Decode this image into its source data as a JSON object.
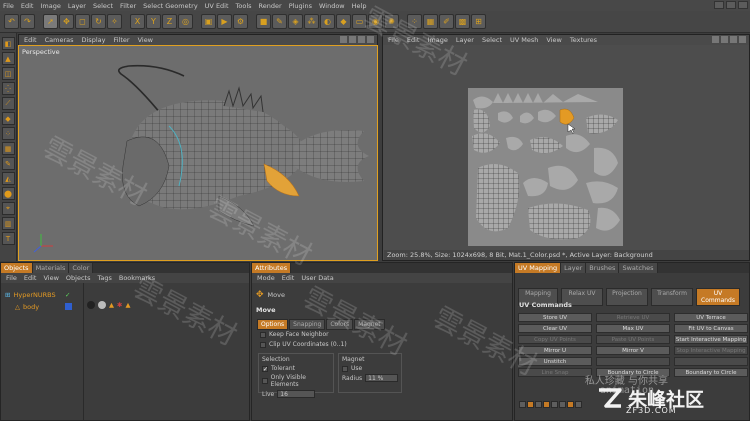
{
  "app": {
    "menu": [
      "File",
      "Edit",
      "Image",
      "Layer",
      "Select",
      "Filter",
      "Select Geometry",
      "UV Edit",
      "Tools",
      "Render",
      "Plugins",
      "Window",
      "Help"
    ]
  },
  "toolbar": {
    "icons": [
      "undo-icon",
      "redo-icon",
      "live-select-icon",
      "move-icon",
      "scale-icon",
      "rotate-icon",
      "last-tool-icon",
      "x-axis-icon",
      "y-axis-icon",
      "z-axis-icon",
      "world-coord-icon",
      "render-region-icon",
      "render-view-icon",
      "render-settings-icon",
      "cube-icon",
      "pen-icon",
      "subdivide-icon",
      "array-icon",
      "boole-icon",
      "deformer-icon",
      "floor-icon",
      "camera-icon",
      "light-icon",
      "uv-points-icon",
      "uv-polygons-icon",
      "paint-icon",
      "texture-icon",
      "layout-icon"
    ]
  },
  "viewport": {
    "menu": [
      "Edit",
      "Cameras",
      "Display",
      "Filter",
      "View"
    ],
    "label": "Perspective"
  },
  "uv_editor": {
    "menu": [
      "File",
      "Edit",
      "Image",
      "Layer",
      "Select",
      "UV Mesh",
      "View",
      "Textures"
    ],
    "status": "Zoom: 25.8%, Size: 1024x698, 8 Bit, Mat.1_Color.psd *, Active Layer: Background"
  },
  "objects_panel": {
    "tabs": [
      "Objects",
      "Materials",
      "Color"
    ],
    "menu": [
      "File",
      "Edit",
      "View",
      "Objects",
      "Tags",
      "Bookmarks"
    ],
    "objects": [
      {
        "name": "HyperNURBS"
      },
      {
        "name": "body"
      }
    ]
  },
  "attributes_panel": {
    "tabs": [
      "Attributes"
    ],
    "menu": [
      "Mode",
      "Edit",
      "User Data"
    ],
    "tool_name": "Move",
    "section_title": "Move",
    "subtabs": [
      "Options",
      "Snapping",
      "Colors",
      "Magnet"
    ],
    "options": {
      "keep_face_neighbor": "Keep Face Neighbor",
      "clip_uv": "Clip UV Coordinates (0..1)"
    },
    "selection": {
      "title": "Selection",
      "tolerant": "Tolerant",
      "only_visible": "Only Visible Elements",
      "live_label": "Live",
      "live_value": "16"
    },
    "magnet": {
      "title": "Magnet",
      "use": "Use",
      "radius_label": "Radius",
      "radius_value": "11 %"
    }
  },
  "uv_panel": {
    "tabs": [
      "UV Mapping",
      "Layer",
      "Brushes",
      "Swatches"
    ],
    "subtabs": [
      "Mapping",
      "Relax UV",
      "Projection",
      "Transform",
      "UV Commands"
    ],
    "title": "UV Commands",
    "buttons": [
      {
        "label": "Store UV",
        "enabled": true
      },
      {
        "label": "Retrieve UV",
        "enabled": false
      },
      {
        "label": "UV Terrace",
        "enabled": true
      },
      {
        "label": "Clear UV",
        "enabled": true
      },
      {
        "label": "Max UV",
        "enabled": true
      },
      {
        "label": "Fit UV to Canvas",
        "enabled": true
      },
      {
        "label": "Copy UV Points",
        "enabled": false
      },
      {
        "label": "Paste UV Points",
        "enabled": false
      },
      {
        "label": "Start Interactive Mapping",
        "enabled": true
      },
      {
        "label": "Mirror U",
        "enabled": true
      },
      {
        "label": "Mirror V",
        "enabled": true
      },
      {
        "label": "Stop Interactive Mapping",
        "enabled": false
      },
      {
        "label": "Unstitch",
        "enabled": true
      },
      {
        "label": "",
        "enabled": false
      },
      {
        "label": "",
        "enabled": false
      },
      {
        "label": "Line Snap",
        "enabled": false
      },
      {
        "label": "Boundary to Circle",
        "enabled": true
      },
      {
        "label": "Boundary to Circle",
        "enabled": true
      }
    ]
  },
  "watermarks": {
    "repeated": "雲景素材",
    "cn_caption": "私人珍藏 与你共享",
    "animation": "animation",
    "site_name": "朱峰社区",
    "site_url": "ZF3D.COM"
  },
  "colors": {
    "accent": "#c57a25",
    "selection_outline": "#e0a020",
    "bg": "#3d3d3d"
  }
}
